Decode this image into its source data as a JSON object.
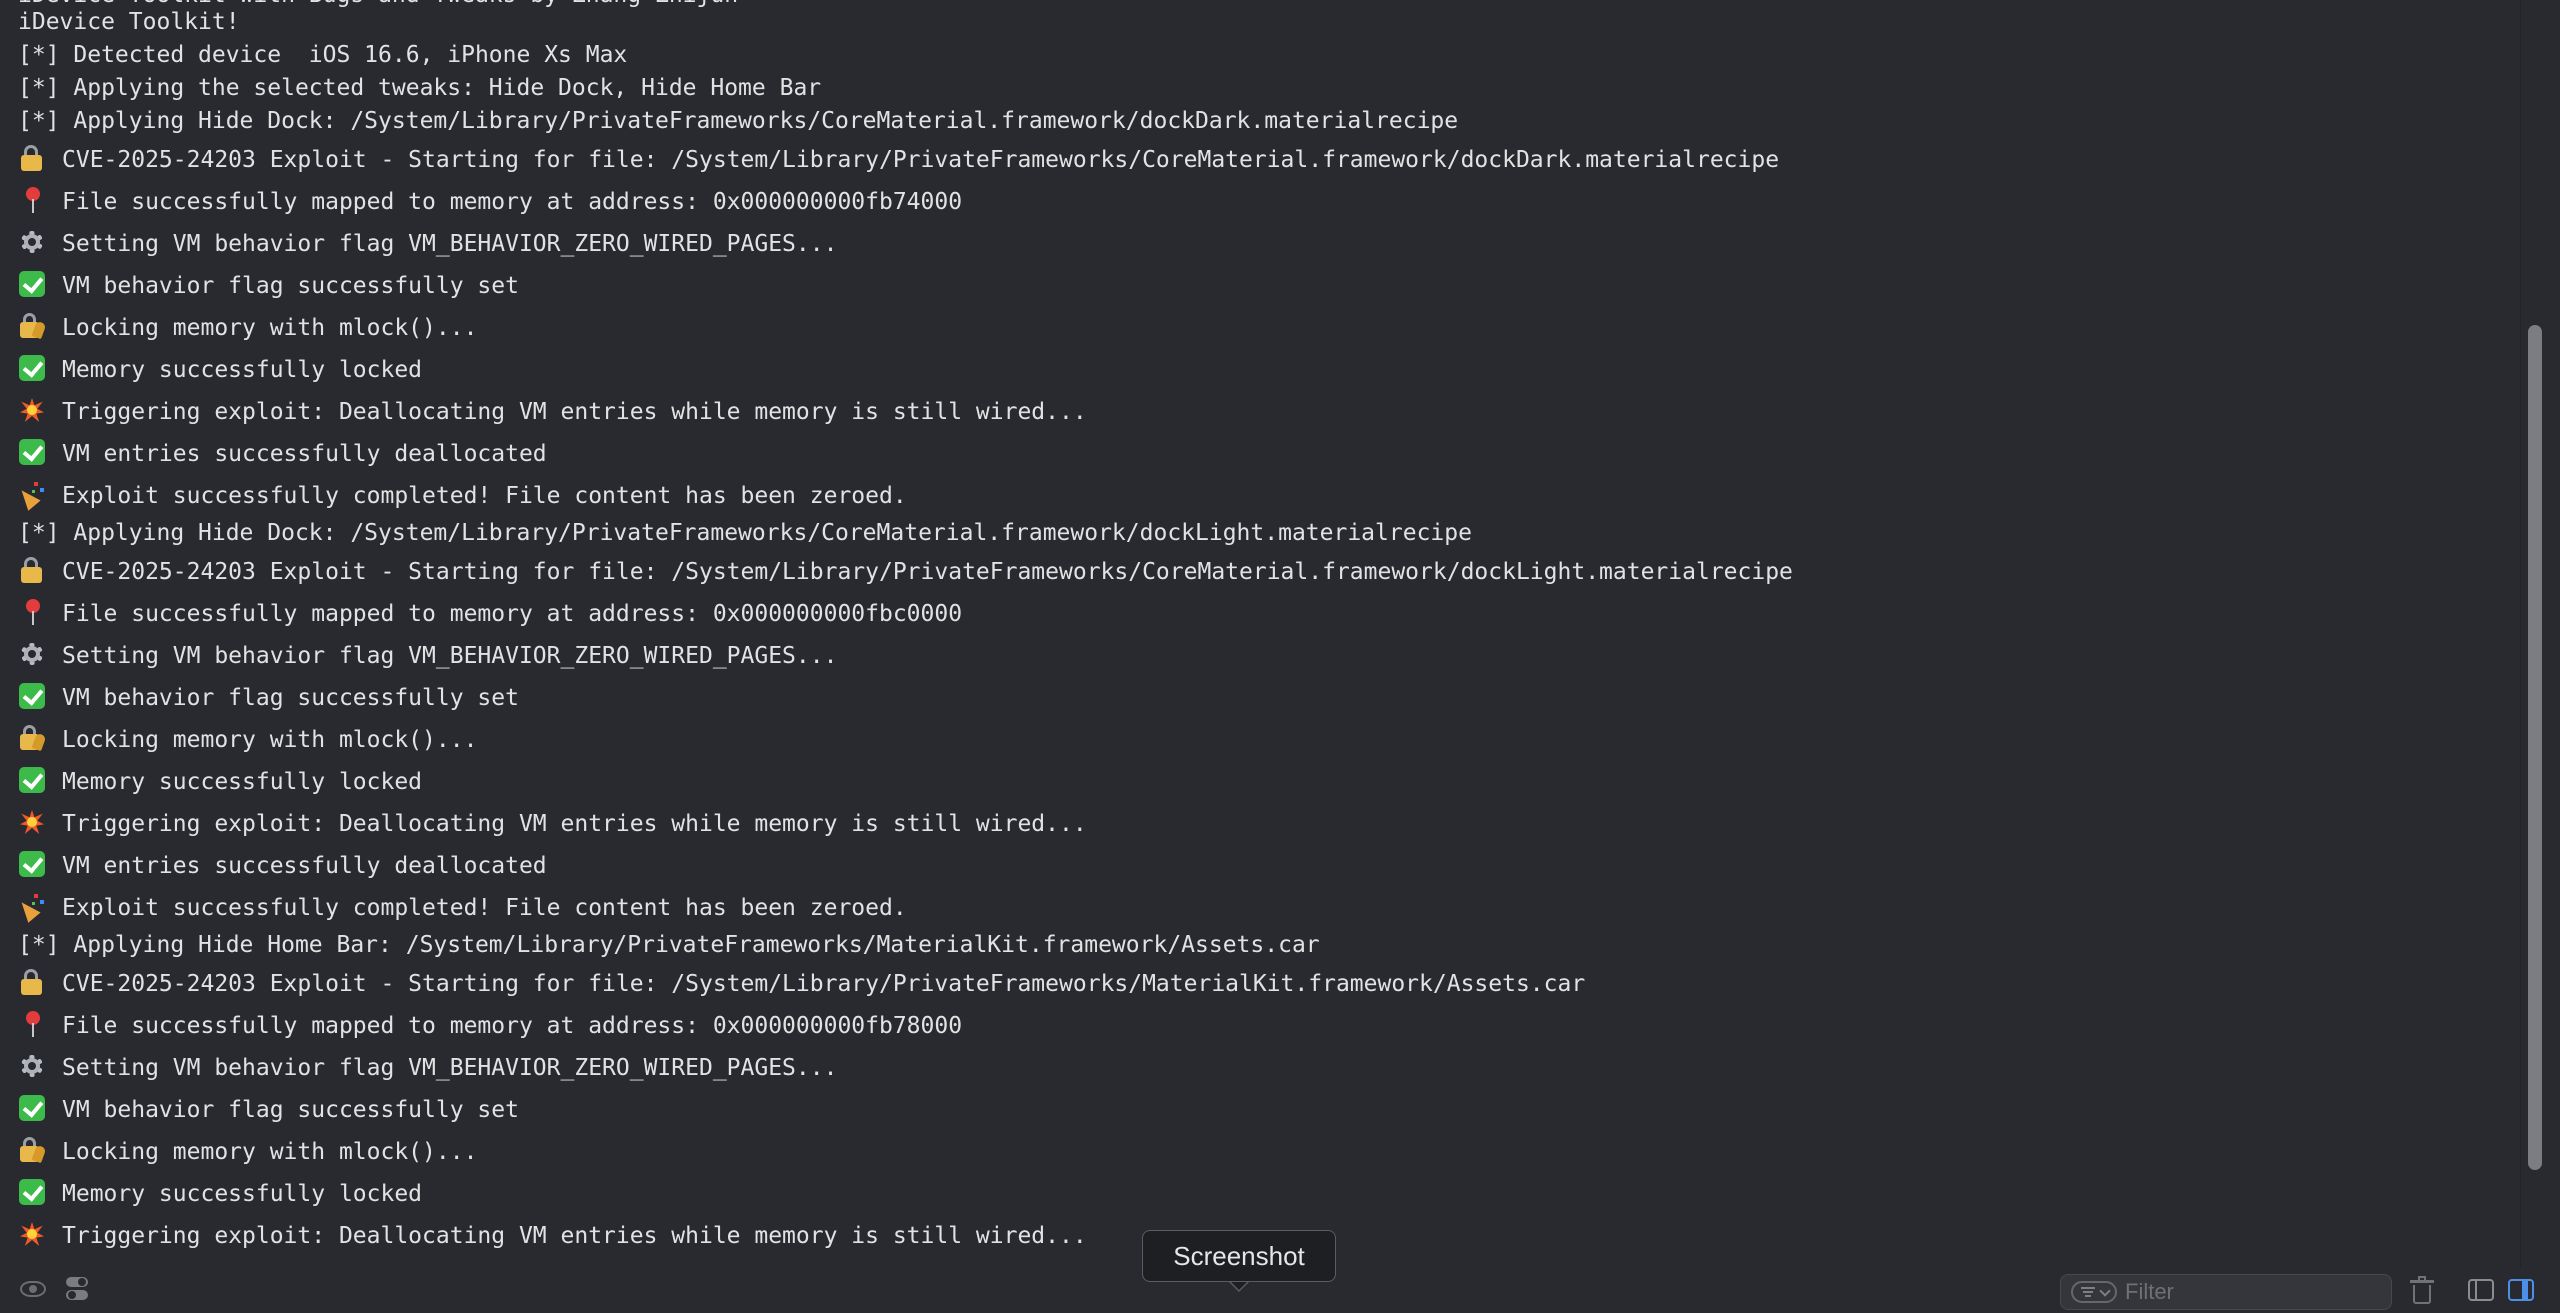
{
  "log": {
    "top_clipped": "iDevice Toolkit with Bugs and Tweaks by Zhang Zhijun",
    "lines": [
      {
        "icon": "",
        "text": "iDevice Toolkit!"
      },
      {
        "icon": "",
        "text": "[*] Detected device  iOS 16.6, iPhone Xs Max"
      },
      {
        "icon": "",
        "text": "[*] Applying the selected tweaks: Hide Dock, Hide Home Bar"
      },
      {
        "icon": "",
        "text": "[*] Applying Hide Dock: /System/Library/PrivateFrameworks/CoreMaterial.framework/dockDark.materialrecipe"
      },
      {
        "icon": "lock",
        "text": "CVE-2025-24203 Exploit - Starting for file: /System/Library/PrivateFrameworks/CoreMaterial.framework/dockDark.materialrecipe"
      },
      {
        "icon": "pin",
        "text": "File successfully mapped to memory at address: 0x000000000fb74000"
      },
      {
        "icon": "gear",
        "text": "Setting VM behavior flag VM_BEHAVIOR_ZERO_WIRED_PAGES..."
      },
      {
        "icon": "check",
        "text": "VM behavior flag successfully set"
      },
      {
        "icon": "lockkey",
        "text": "Locking memory with mlock()..."
      },
      {
        "icon": "check",
        "text": "Memory successfully locked"
      },
      {
        "icon": "boom",
        "text": "Triggering exploit: Deallocating VM entries while memory is still wired..."
      },
      {
        "icon": "check",
        "text": "VM entries successfully deallocated"
      },
      {
        "icon": "party",
        "text": "Exploit successfully completed! File content has been zeroed."
      },
      {
        "icon": "",
        "text": "[*] Applying Hide Dock: /System/Library/PrivateFrameworks/CoreMaterial.framework/dockLight.materialrecipe"
      },
      {
        "icon": "lock",
        "text": "CVE-2025-24203 Exploit - Starting for file: /System/Library/PrivateFrameworks/CoreMaterial.framework/dockLight.materialrecipe"
      },
      {
        "icon": "pin",
        "text": "File successfully mapped to memory at address: 0x000000000fbc0000"
      },
      {
        "icon": "gear",
        "text": "Setting VM behavior flag VM_BEHAVIOR_ZERO_WIRED_PAGES..."
      },
      {
        "icon": "check",
        "text": "VM behavior flag successfully set"
      },
      {
        "icon": "lockkey",
        "text": "Locking memory with mlock()..."
      },
      {
        "icon": "check",
        "text": "Memory successfully locked"
      },
      {
        "icon": "boom",
        "text": "Triggering exploit: Deallocating VM entries while memory is still wired..."
      },
      {
        "icon": "check",
        "text": "VM entries successfully deallocated"
      },
      {
        "icon": "party",
        "text": "Exploit successfully completed! File content has been zeroed."
      },
      {
        "icon": "",
        "text": "[*] Applying Hide Home Bar: /System/Library/PrivateFrameworks/MaterialKit.framework/Assets.car"
      },
      {
        "icon": "lock",
        "text": "CVE-2025-24203 Exploit - Starting for file: /System/Library/PrivateFrameworks/MaterialKit.framework/Assets.car"
      },
      {
        "icon": "pin",
        "text": "File successfully mapped to memory at address: 0x000000000fb78000"
      },
      {
        "icon": "gear",
        "text": "Setting VM behavior flag VM_BEHAVIOR_ZERO_WIRED_PAGES..."
      },
      {
        "icon": "check",
        "text": "VM behavior flag successfully set"
      },
      {
        "icon": "lockkey",
        "text": "Locking memory with mlock()..."
      },
      {
        "icon": "check",
        "text": "Memory successfully locked"
      },
      {
        "icon": "boom",
        "text": "Triggering exploit: Deallocating VM entries while memory is still wired..."
      }
    ]
  },
  "tooltip": {
    "label": "Screenshot"
  },
  "filter": {
    "placeholder": "Filter",
    "value": ""
  },
  "colors": {
    "background": "#292a2f",
    "text": "#e2e2e4",
    "accent": "#4c8fe8"
  }
}
